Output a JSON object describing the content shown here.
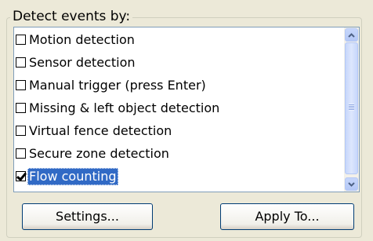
{
  "group": {
    "title": "Detect events by:"
  },
  "event_list": {
    "items": [
      {
        "label": "Motion detection",
        "checked": false,
        "selected": false
      },
      {
        "label": "Sensor detection",
        "checked": false,
        "selected": false
      },
      {
        "label": "Manual trigger (press Enter)",
        "checked": false,
        "selected": false
      },
      {
        "label": "Missing & left object detection",
        "checked": false,
        "selected": false
      },
      {
        "label": "Virtual fence detection",
        "checked": false,
        "selected": false
      },
      {
        "label": "Secure zone detection",
        "checked": false,
        "selected": false
      },
      {
        "label": "Flow counting",
        "checked": true,
        "selected": true
      }
    ]
  },
  "buttons": {
    "settings": "Settings...",
    "apply_to": "Apply To..."
  },
  "icons": {
    "scroll_up": "chevron-up-icon",
    "scroll_down": "chevron-down-icon"
  },
  "colors": {
    "selection": "#316ac5",
    "scroll_arrow": "#4d6185",
    "list_border": "#7f9db9"
  }
}
